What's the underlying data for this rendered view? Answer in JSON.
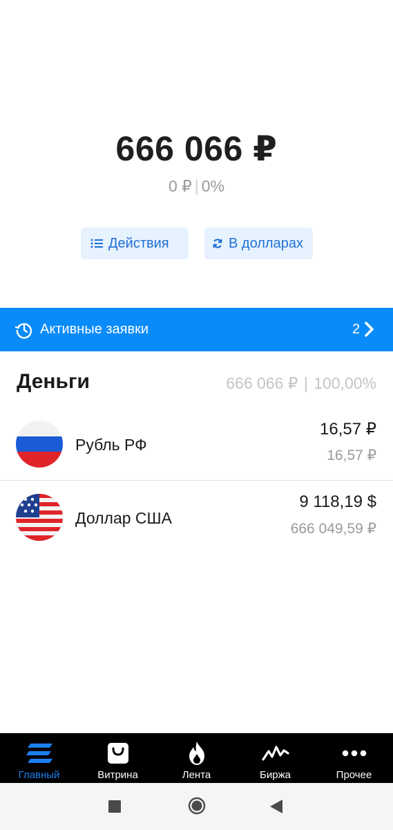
{
  "balance": {
    "total": "666 066 ₽",
    "change_amount": "0 ₽",
    "change_separator": "|",
    "change_percent": "0%"
  },
  "actions": {
    "actions_label": "Действия",
    "dollars_label": "В долларах"
  },
  "active_orders": {
    "label": "Активные заявки",
    "count": "2"
  },
  "money_section": {
    "title": "Деньги",
    "total": "666 066 ₽",
    "separator": "|",
    "share": "100,00%"
  },
  "assets": [
    {
      "name": "Рубль РФ",
      "amount": "16,57 ₽",
      "value": "16,57 ₽",
      "icon": "russia-flag-icon"
    },
    {
      "name": "Доллар США",
      "amount": "9 118,19 $",
      "value": "666 049,59 ₽",
      "icon": "usa-flag-icon"
    }
  ],
  "tabbar": {
    "tabs": [
      {
        "label": "Главный",
        "icon": "home-icon",
        "active": true
      },
      {
        "label": "Витрина",
        "icon": "shopping-bag-icon",
        "active": false
      },
      {
        "label": "Лента",
        "icon": "flame-icon",
        "active": false
      },
      {
        "label": "Биржа",
        "icon": "chart-pulse-icon",
        "active": false
      },
      {
        "label": "Прочее",
        "icon": "more-dots-icon",
        "active": false
      }
    ]
  },
  "colors": {
    "accent": "#0a8bfa",
    "active_tab": "#1a7ff0",
    "pill_bg": "#e6f2fd",
    "muted_text": "#9a9a9a"
  }
}
